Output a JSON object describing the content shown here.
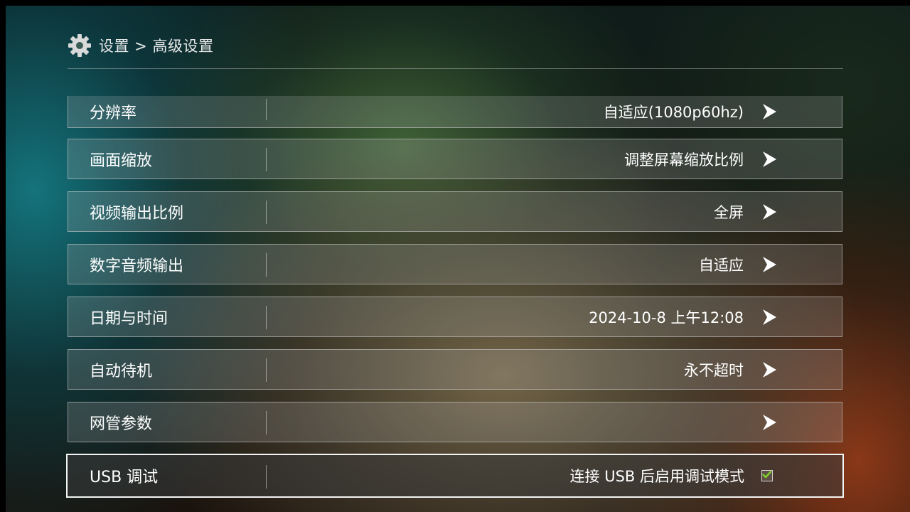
{
  "header": {
    "breadcrumb": "设置 > 高级设置",
    "icon": "gear-icon"
  },
  "settings": [
    {
      "label": "分辨率",
      "value": "自适应(1080p60hz)",
      "control": "arrow"
    },
    {
      "label": "画面缩放",
      "value": "调整屏幕缩放比例",
      "control": "arrow"
    },
    {
      "label": "视频输出比例",
      "value": "全屏",
      "control": "arrow"
    },
    {
      "label": "数字音频输出",
      "value": "自适应",
      "control": "arrow"
    },
    {
      "label": "日期与时间",
      "value": "2024-10-8 上午12:08",
      "control": "arrow"
    },
    {
      "label": "自动待机",
      "value": "永不超时",
      "control": "arrow"
    },
    {
      "label": "网管参数",
      "value": "",
      "control": "arrow"
    },
    {
      "label": "USB 调试",
      "value": "连接 USB 后启用调试模式",
      "control": "checkbox",
      "checked": true,
      "selected": true
    }
  ],
  "colors": {
    "text": "#ffffff",
    "checkmark": "#7fd12a"
  }
}
